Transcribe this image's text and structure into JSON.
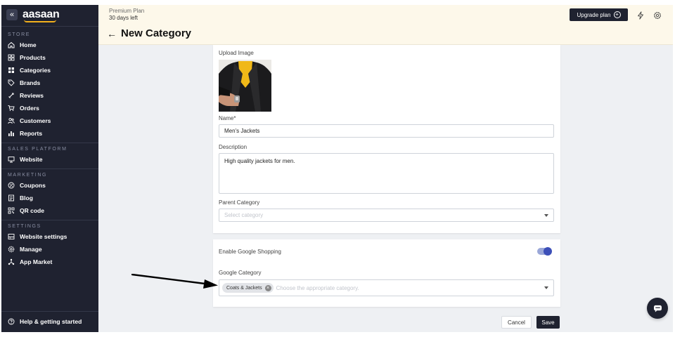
{
  "sidebar": {
    "logo": "aasaan",
    "collapse_glyph": "«",
    "sections": [
      {
        "label": "STORE",
        "items": [
          {
            "label": "Home",
            "icon": "home-icon"
          },
          {
            "label": "Products",
            "icon": "products-icon"
          },
          {
            "label": "Categories",
            "icon": "categories-icon"
          },
          {
            "label": "Brands",
            "icon": "tag-icon"
          },
          {
            "label": "Reviews",
            "icon": "reviews-icon"
          },
          {
            "label": "Orders",
            "icon": "cart-icon"
          },
          {
            "label": "Customers",
            "icon": "customers-icon"
          },
          {
            "label": "Reports",
            "icon": "bar-chart-icon"
          }
        ]
      },
      {
        "label": "SALES PLATFORM",
        "items": [
          {
            "label": "Website",
            "icon": "monitor-icon"
          }
        ]
      },
      {
        "label": "MARKETING",
        "items": [
          {
            "label": "Coupons",
            "icon": "coupon-icon"
          },
          {
            "label": "Blog",
            "icon": "blog-icon"
          },
          {
            "label": "QR code",
            "icon": "qr-code-icon"
          }
        ]
      },
      {
        "label": "SETTINGS",
        "items": [
          {
            "label": "Website settings",
            "icon": "website-settings-icon"
          },
          {
            "label": "Manage",
            "icon": "gear-icon"
          },
          {
            "label": "App Market",
            "icon": "app-market-icon"
          }
        ]
      }
    ],
    "help": {
      "label": "Help & getting started",
      "icon": "help-icon"
    }
  },
  "topbar": {
    "plan_name": "Premium Plan",
    "plan_days": "30 days left",
    "back_glyph": "←",
    "page_title": "New Category",
    "upgrade_label": "Upgrade plan",
    "upgrade_glyph": "+"
  },
  "form": {
    "upload_label": "Upload Image",
    "name_label": "Name*",
    "name_value": "Men's Jackets",
    "description_label": "Description",
    "description_value": "High quality jackets for men.",
    "parent_label": "Parent Category",
    "parent_placeholder": "Select category",
    "google_shopping_label": "Enable Google Shopping",
    "google_shopping_enabled": true,
    "google_category_label": "Google Category",
    "google_category_chip": "Coats & Jackets",
    "chip_remove_glyph": "×",
    "google_category_placeholder": "Choose the appropriate category."
  },
  "actions": {
    "cancel_label": "Cancel",
    "save_label": "Save"
  },
  "colors": {
    "sidebar_bg": "#1f2230",
    "topbar_bg": "#fdf8ea",
    "toggle_on": "#3c4fb8",
    "logo_accent": "#f3b11c"
  }
}
